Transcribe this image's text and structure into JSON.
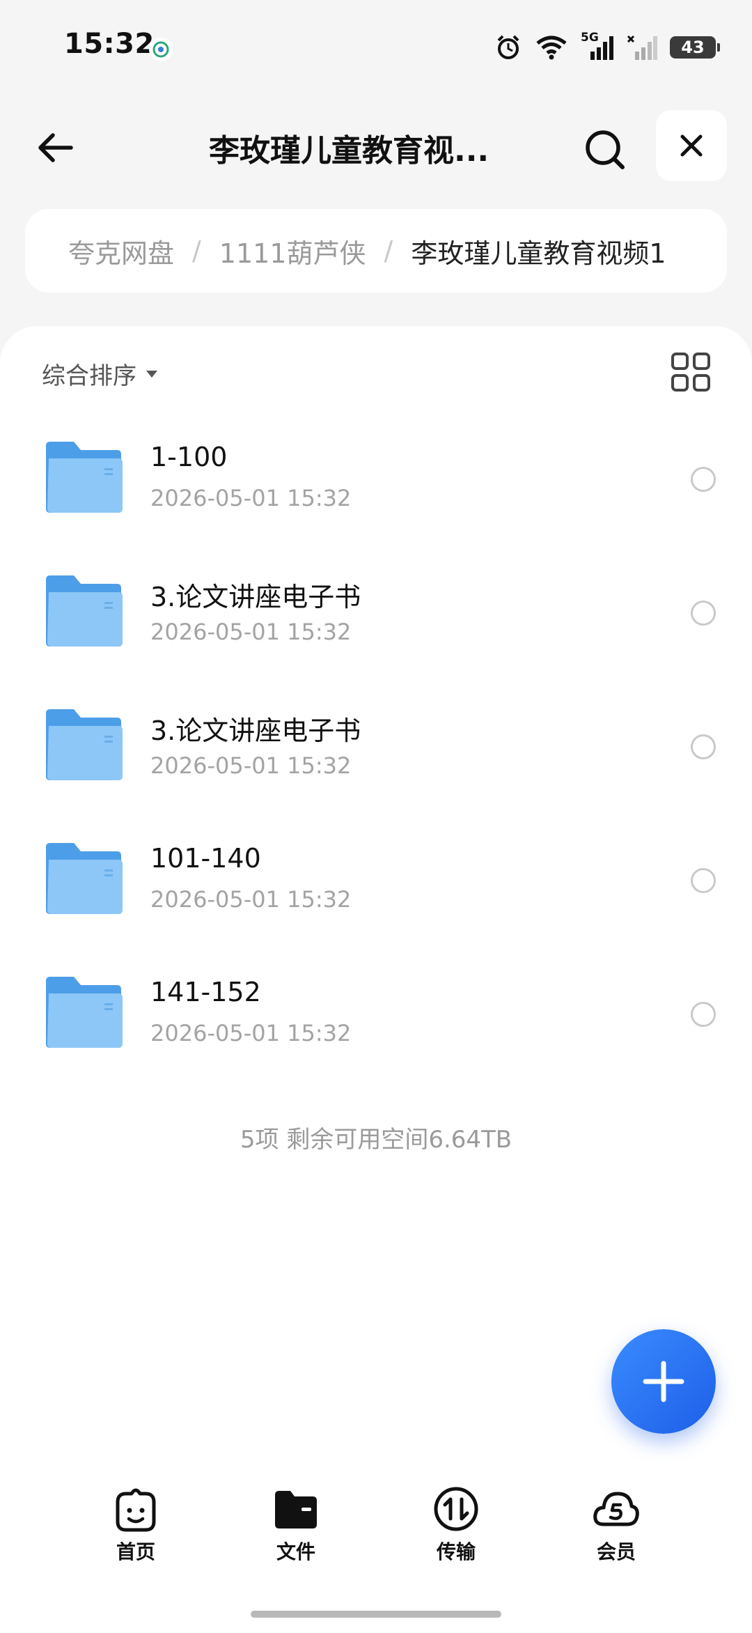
{
  "status_bar": {
    "time": "15:32",
    "network": "5G",
    "battery": "43",
    "icons": [
      "alarm-icon",
      "wifi-icon",
      "signal-icon",
      "signal-icon-secondary",
      "battery-icon"
    ]
  },
  "header": {
    "title": "李玫瑾儿童教育视...",
    "back_icon": "arrow-left-icon",
    "search_icon": "search-icon",
    "close_icon": "close-icon"
  },
  "breadcrumb": {
    "items": [
      "夸克网盘",
      "1111葫芦侠",
      "李玫瑾儿童教育视频1"
    ],
    "separator": "/"
  },
  "toolbar": {
    "sort_label": "综合排序",
    "sort_icon": "caret-down-icon",
    "view_toggle_icon": "grid-view-icon"
  },
  "files": [
    {
      "name": "1-100",
      "date": "2026-05-01 15:32"
    },
    {
      "name": "3.论文讲座电子书",
      "date": "2026-05-01 15:32"
    },
    {
      "name": "3.论文讲座电子书",
      "date": "2026-05-01 15:32"
    },
    {
      "name": "101-140",
      "date": "2026-05-01 15:32"
    },
    {
      "name": "141-152",
      "date": "2026-05-01 15:32"
    }
  ],
  "summary": "5项 剩余可用空间6.64TB",
  "fab_icon": "plus-icon",
  "nav": {
    "items": [
      {
        "label": "首页",
        "icon": "home-face-icon"
      },
      {
        "label": "文件",
        "icon": "folder-icon"
      },
      {
        "label": "传输",
        "icon": "transfer-icon"
      },
      {
        "label": "会员",
        "icon": "cloud-member-icon"
      }
    ]
  },
  "colors": {
    "accent": "#1d5fe8",
    "folder": "#5aaaf0",
    "background": "#f5f5f6"
  }
}
